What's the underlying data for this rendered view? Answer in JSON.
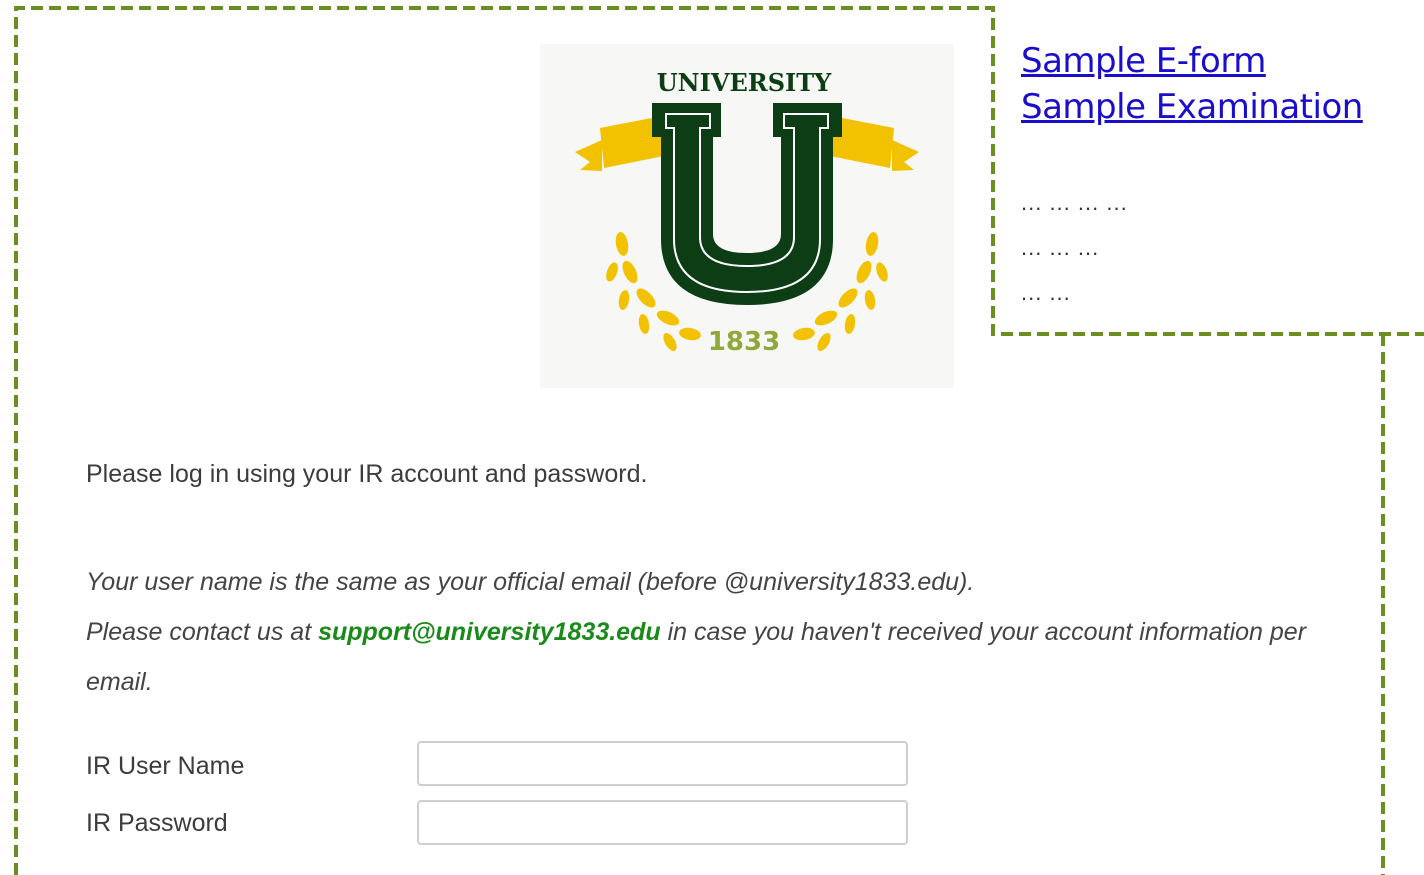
{
  "logo": {
    "wordmark": "UNIVERSITY",
    "letter": "U",
    "year": "1833",
    "colors": {
      "green": "#0d3d14",
      "gold": "#f2c200",
      "olive": "#8fa83a"
    }
  },
  "links": [
    {
      "label": "Sample E-form"
    },
    {
      "label": "Sample Examination"
    }
  ],
  "placeholder_lines": [
    "... ... ... ...",
    "... ... ...",
    "... ..."
  ],
  "intro": "Please log in using your IR account and password.",
  "note": {
    "line1": "Your user name is the same as your official email (before @university1833.edu).",
    "line2_prefix": "Please contact us at ",
    "email": "support@university1833.edu",
    "line2_suffix": " in case you haven't received your account information per email."
  },
  "form": {
    "username_label": "IR User Name",
    "username_value": "",
    "password_label": "IR Password",
    "password_value": ""
  },
  "frame_color": "#6b8e23"
}
